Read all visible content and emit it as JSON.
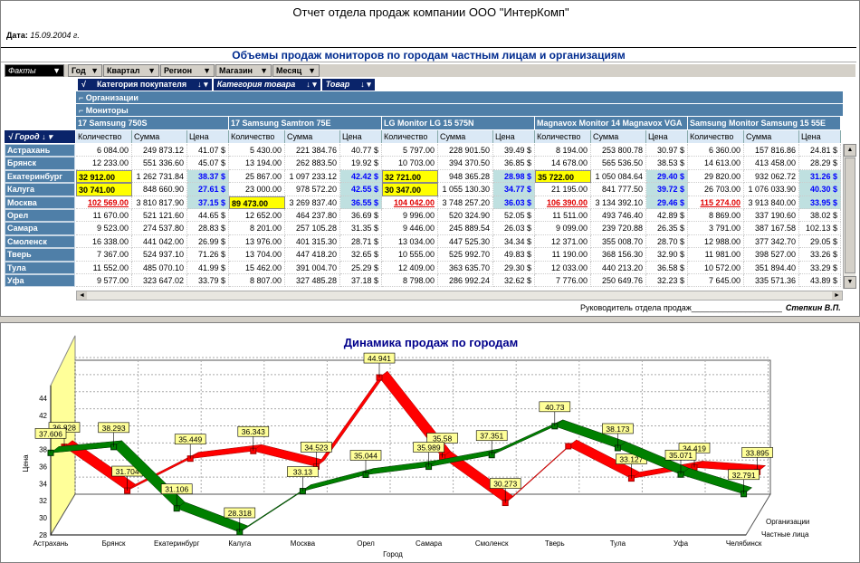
{
  "report": {
    "title": "Отчет отдела продаж компании ООО \"ИнтерКомп\"",
    "date_label": "Дата:",
    "date_value": "15.09.2004 г.",
    "subtitle": "Объемы продаж мониторов по городам частным лицам и организациям"
  },
  "toolbar": {
    "facts": "Факты",
    "filters": [
      "Год",
      "Квартал",
      "Регион",
      "Магазин",
      "Месяц"
    ]
  },
  "col_dims": [
    "Категория покупателя",
    "Категория товара",
    "Товар"
  ],
  "bands": [
    "Организации",
    "Мониторы"
  ],
  "row_dim": "Город",
  "measures": [
    "Количество",
    "Сумма",
    "Цена"
  ],
  "products": [
    "17 Samsung 750S",
    "17 Samsung Samtron 75E",
    "LG Monitor LG 15 575N",
    "Magnavox Monitor 14 Magnavox VGA",
    "Samsung Monitor Samsung 15 55E"
  ],
  "rows": [
    {
      "city": "Астрахань",
      "cells": [
        [
          "6 084.00",
          "249 873.12",
          "41.07 $"
        ],
        [
          "5 430.00",
          "221 384.76",
          "40.77 $"
        ],
        [
          "5 797.00",
          "228 901.50",
          "39.49 $"
        ],
        [
          "8 194.00",
          "253 800.78",
          "30.97 $"
        ],
        [
          "6 360.00",
          "157 816.86",
          "24.81 $"
        ]
      ],
      "qstyle": [
        "",
        "",
        "",
        "",
        ""
      ],
      "pstyle": ""
    },
    {
      "city": "Брянск",
      "cells": [
        [
          "12 233.00",
          "551 336.60",
          "45.07 $"
        ],
        [
          "13 194.00",
          "262 883.50",
          "19.92 $"
        ],
        [
          "10 703.00",
          "394 370.50",
          "36.85 $"
        ],
        [
          "14 678.00",
          "565 536.50",
          "38.53 $"
        ],
        [
          "14 613.00",
          "413 458.00",
          "28.29 $"
        ]
      ],
      "qstyle": [
        "",
        "",
        "",
        "",
        ""
      ],
      "pstyle": ""
    },
    {
      "city": "Екатеринбург",
      "cells": [
        [
          "32 912.00",
          "1 262 731.84",
          "38.37 $"
        ],
        [
          "25 867.00",
          "1 097 233.12",
          "42.42 $"
        ],
        [
          "32 721.00",
          "948 365.28",
          "28.98 $"
        ],
        [
          "35 722.00",
          "1 050 084.64",
          "29.40 $"
        ],
        [
          "29 820.00",
          "932 062.72",
          "31.26 $"
        ]
      ],
      "qstyle": [
        "y",
        "",
        "y",
        "y",
        ""
      ],
      "pstyle": "b"
    },
    {
      "city": "Калуга",
      "cells": [
        [
          "30 741.00",
          "848 660.90",
          "27.61 $"
        ],
        [
          "23 000.00",
          "978 572.20",
          "42.55 $"
        ],
        [
          "30 347.00",
          "1 055 130.30",
          "34.77 $"
        ],
        [
          "21 195.00",
          "841 777.50",
          "39.72 $"
        ],
        [
          "26 703.00",
          "1 076 033.90",
          "40.30 $"
        ]
      ],
      "qstyle": [
        "y",
        "",
        "y",
        "",
        ""
      ],
      "pstyle": "b"
    },
    {
      "city": "Москва",
      "cells": [
        [
          "102 569.00",
          "3 810 817.90",
          "37.15 $"
        ],
        [
          "89 473.00",
          "3 269 837.40",
          "36.55 $"
        ],
        [
          "104 042.00",
          "3 748 257.20",
          "36.03 $"
        ],
        [
          "106 390.00",
          "3 134 392.10",
          "29.46 $"
        ],
        [
          "115 274.00",
          "3 913 840.00",
          "33.95 $"
        ]
      ],
      "qstyle": [
        "r",
        "y",
        "r",
        "r",
        "r"
      ],
      "pstyle": "b"
    },
    {
      "city": "Орел",
      "cells": [
        [
          "11 670.00",
          "521 121.60",
          "44.65 $"
        ],
        [
          "12 652.00",
          "464 237.80",
          "36.69 $"
        ],
        [
          "9 996.00",
          "520 324.90",
          "52.05 $"
        ],
        [
          "11 511.00",
          "493 746.40",
          "42.89 $"
        ],
        [
          "8 869.00",
          "337 190.60",
          "38.02 $"
        ]
      ],
      "qstyle": [
        "",
        "",
        "",
        "",
        ""
      ],
      "pstyle": ""
    },
    {
      "city": "Самара",
      "cells": [
        [
          "9 523.00",
          "274 537.80",
          "28.83 $"
        ],
        [
          "8 201.00",
          "257 105.28",
          "31.35 $"
        ],
        [
          "9 446.00",
          "245 889.54",
          "26.03 $"
        ],
        [
          "9 099.00",
          "239 720.88",
          "26.35 $"
        ],
        [
          "3 791.00",
          "387 167.58",
          "102.13 $"
        ]
      ],
      "qstyle": [
        "",
        "",
        "",
        "",
        ""
      ],
      "pstyle": ""
    },
    {
      "city": "Смоленск",
      "cells": [
        [
          "16 338.00",
          "441 042.00",
          "26.99 $"
        ],
        [
          "13 976.00",
          "401 315.30",
          "28.71 $"
        ],
        [
          "13 034.00",
          "447 525.30",
          "34.34 $"
        ],
        [
          "12 371.00",
          "355 008.70",
          "28.70 $"
        ],
        [
          "12 988.00",
          "377 342.70",
          "29.05 $"
        ]
      ],
      "qstyle": [
        "",
        "",
        "",
        "",
        ""
      ],
      "pstyle": ""
    },
    {
      "city": "Тверь",
      "cells": [
        [
          "7 367.00",
          "524 937.10",
          "71.26 $"
        ],
        [
          "13 704.00",
          "447 418.20",
          "32.65 $"
        ],
        [
          "10 555.00",
          "525 992.70",
          "49.83 $"
        ],
        [
          "11 190.00",
          "368 156.30",
          "32.90 $"
        ],
        [
          "11 981.00",
          "398 527.00",
          "33.26 $"
        ]
      ],
      "qstyle": [
        "",
        "",
        "",
        "",
        ""
      ],
      "pstyle": ""
    },
    {
      "city": "Тула",
      "cells": [
        [
          "11 552.00",
          "485 070.10",
          "41.99 $"
        ],
        [
          "15 462.00",
          "391 004.70",
          "25.29 $"
        ],
        [
          "12 409.00",
          "363 635.70",
          "29.30 $"
        ],
        [
          "12 033.00",
          "440 213.20",
          "36.58 $"
        ],
        [
          "10 572.00",
          "351 894.40",
          "33.29 $"
        ]
      ],
      "qstyle": [
        "",
        "",
        "",
        "",
        ""
      ],
      "pstyle": ""
    },
    {
      "city": "Уфа",
      "cells": [
        [
          "9 577.00",
          "323 647.02",
          "33.79 $"
        ],
        [
          "8 807.00",
          "327 485.28",
          "37.18 $"
        ],
        [
          "8 798.00",
          "286 992.24",
          "32.62 $"
        ],
        [
          "7 776.00",
          "250 649.76",
          "32.23 $"
        ],
        [
          "7 645.00",
          "335 571.36",
          "43.89 $"
        ]
      ],
      "qstyle": [
        "",
        "",
        "",
        "",
        ""
      ],
      "pstyle": ""
    }
  ],
  "signature": {
    "label": "Руководитель отдела продаж____________________",
    "name": "Степкин В.П."
  },
  "chart_data": {
    "type": "line",
    "title": "Динамика продаж по городам",
    "xlabel": "Город",
    "ylabel": "Цена",
    "ylim": [
      28,
      45
    ],
    "yticks": [
      28,
      30,
      32,
      34,
      36,
      38,
      40,
      42,
      44
    ],
    "categories": [
      "Астрахань",
      "Брянск",
      "Екатеринбург",
      "Калуга",
      "Москва",
      "Орел",
      "Самара",
      "Смоленск",
      "Тверь",
      "Тула",
      "Уфа",
      "Челябинск"
    ],
    "series": [
      {
        "name": "Организации",
        "color": "#ff0000",
        "values": [
          36.828,
          31.704,
          35.449,
          36.343,
          34.523,
          44.941,
          35.58,
          30.273,
          36.9,
          33.127,
          34.419,
          33.895
        ],
        "labels": [
          "36.828",
          "31.704",
          "35.449",
          "36.343",
          "34.523",
          "44.941",
          "35.58",
          "30.273",
          "",
          "33.127",
          "34.419",
          "33.895"
        ]
      },
      {
        "name": "Частные лица",
        "color": "#008000",
        "values": [
          37.606,
          38.293,
          31.106,
          28.318,
          33.13,
          35.044,
          35.989,
          37.351,
          40.73,
          38.173,
          35.071,
          32.791
        ],
        "labels": [
          "37.606",
          "38.293",
          "31.106",
          "28.318",
          "33.13",
          "35.044",
          "35.989",
          "37.351",
          "40.73",
          "38.173",
          "35.071",
          "32.791"
        ]
      }
    ]
  }
}
